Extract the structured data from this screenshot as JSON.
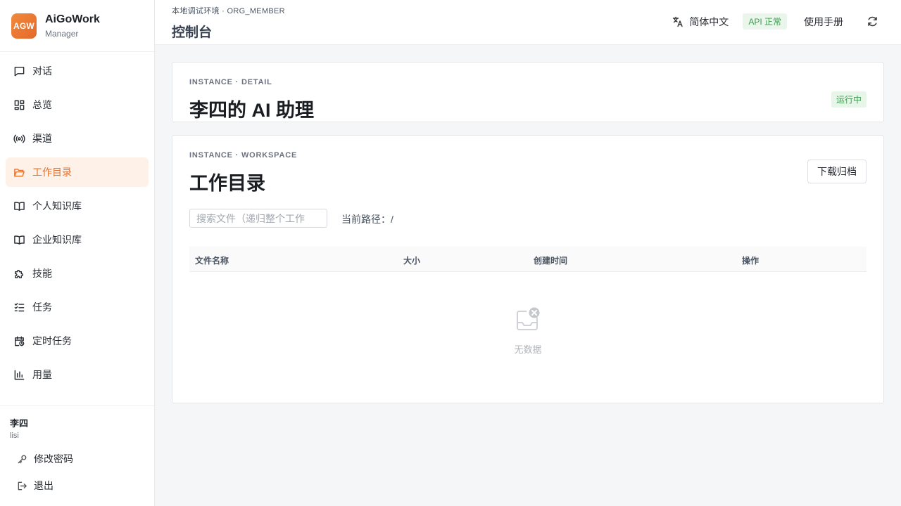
{
  "brand": {
    "logo": "AGW",
    "name": "AiGoWork",
    "role": "Manager"
  },
  "nav": [
    {
      "label": "对话",
      "icon": "chat-icon"
    },
    {
      "label": "总览",
      "icon": "dashboard-icon"
    },
    {
      "label": "渠道",
      "icon": "broadcast-icon"
    },
    {
      "label": "工作目录",
      "icon": "folder-open-icon",
      "active": true
    },
    {
      "label": "个人知识库",
      "icon": "book-icon"
    },
    {
      "label": "企业知识库",
      "icon": "book-icon"
    },
    {
      "label": "技能",
      "icon": "puzzle-icon"
    },
    {
      "label": "任务",
      "icon": "checklist-icon"
    },
    {
      "label": "定时任务",
      "icon": "calendar-clock-icon"
    },
    {
      "label": "用量",
      "icon": "bar-chart-icon"
    }
  ],
  "user": {
    "name": "李四",
    "id": "lisi",
    "change_password": "修改密码",
    "logout": "退出"
  },
  "header": {
    "env": "本地调试环境 · ORG_MEMBER",
    "title": "控制台",
    "language": "简体中文",
    "api_status": "API 正常",
    "manual": "使用手册"
  },
  "instance": {
    "eyebrow": "INSTANCE · DETAIL",
    "title": "李四的 AI 助理",
    "status": "运行中"
  },
  "workspace": {
    "eyebrow": "INSTANCE · WORKSPACE",
    "title": "工作目录",
    "download_label": "下载归档",
    "search_placeholder": "搜索文件（递归整个工作",
    "current_path": "当前路径：/",
    "columns": [
      "文件名称",
      "大小",
      "创建时间",
      "操作"
    ],
    "empty_text": "无数据"
  },
  "colors": {
    "accent": "#e4732f",
    "active_bg": "#fdf1e8",
    "success": "#3e9a4f",
    "success_bg": "#eaf6ec"
  }
}
